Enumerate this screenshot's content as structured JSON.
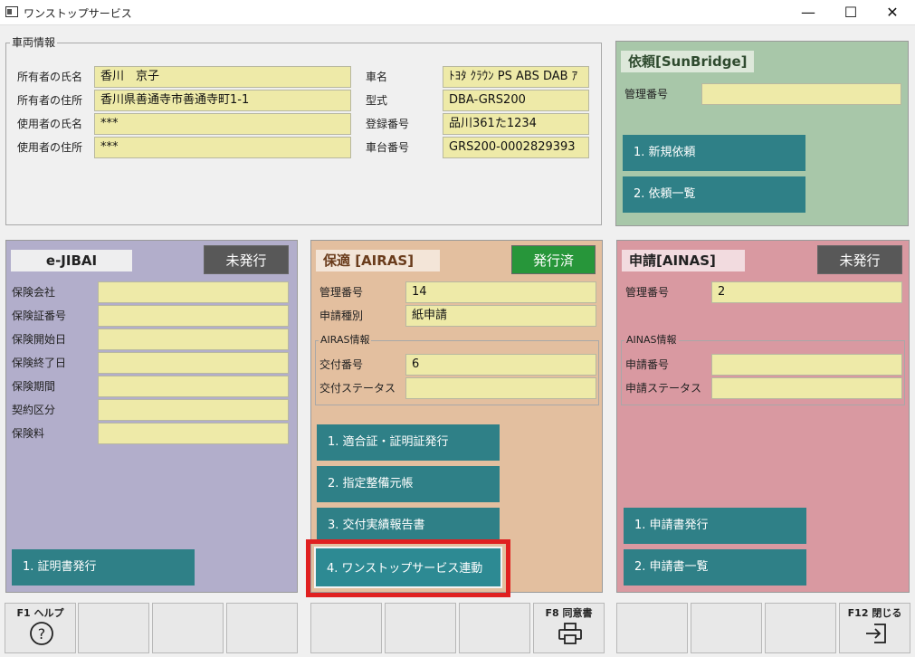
{
  "window": {
    "title": "ワンストップサービス",
    "min": "—",
    "max": "☐",
    "close": "✕"
  },
  "vehicle": {
    "legend": "車両情報",
    "owner_name_label": "所有者の氏名",
    "owner_name": "香川　京子",
    "owner_address_label": "所有者の住所",
    "owner_address": "香川県善通寺市善通寺町1-1",
    "user_name_label": "使用者の氏名",
    "user_name": "***",
    "user_address_label": "使用者の住所",
    "user_address": "***",
    "car_name_label": "車名",
    "car_name": "ﾄﾖﾀ ｸﾗｳﾝ PS ABS DAB ｱ",
    "model_label": "型式",
    "model": "DBA-GRS200",
    "reg_no_label": "登録番号",
    "reg_no": "品川361た1234",
    "chassis_no_label": "車台番号",
    "chassis_no": "GRS200-0002829393"
  },
  "sunbridge": {
    "title": "依頼[SunBridge]",
    "mgmt_label": "管理番号",
    "mgmt_value": "",
    "btn1": "1. 新規依頼",
    "btn2": "2. 依頼一覧"
  },
  "ejibai": {
    "title": "e-JIBAI",
    "status": "未発行",
    "labels": [
      "保険会社",
      "保険証番号",
      "保険開始日",
      "保険終了日",
      "保険期間",
      "契約区分",
      "保険料"
    ],
    "btn1": "1. 証明書発行"
  },
  "airas": {
    "title": "保適 [AIRAS]",
    "status": "発行済",
    "mgmt_label": "管理番号",
    "mgmt_value": "14",
    "type_label": "申請種別",
    "type_value": "紙申請",
    "group_legend": "AIRAS情報",
    "issue_no_label": "交付番号",
    "issue_no": "6",
    "issue_status_label": "交付ステータス",
    "issue_status": "",
    "btn1": "1. 適合証・証明証発行",
    "btn2": "2. 指定整備元帳",
    "btn3": "3. 交付実績報告書",
    "btn4": "4. ワンストップサービス連動"
  },
  "ainas": {
    "title": "申請[AINAS]",
    "status": "未発行",
    "mgmt_label": "管理番号",
    "mgmt_value": "2",
    "group_legend": "AINAS情報",
    "app_no_label": "申請番号",
    "app_no": "",
    "app_status_label": "申請ステータス",
    "app_status": "",
    "btn1": "1. 申請書発行",
    "btn2": "2. 申請書一覧"
  },
  "fkeys": {
    "f1": "F1 ヘルプ",
    "f8": "F8 同意書",
    "f12": "F12 閉じる"
  },
  "colors": {
    "teal": "#2f8087",
    "highlight": "#e02020",
    "issued": "#27963a",
    "not_issued": "#585858"
  }
}
